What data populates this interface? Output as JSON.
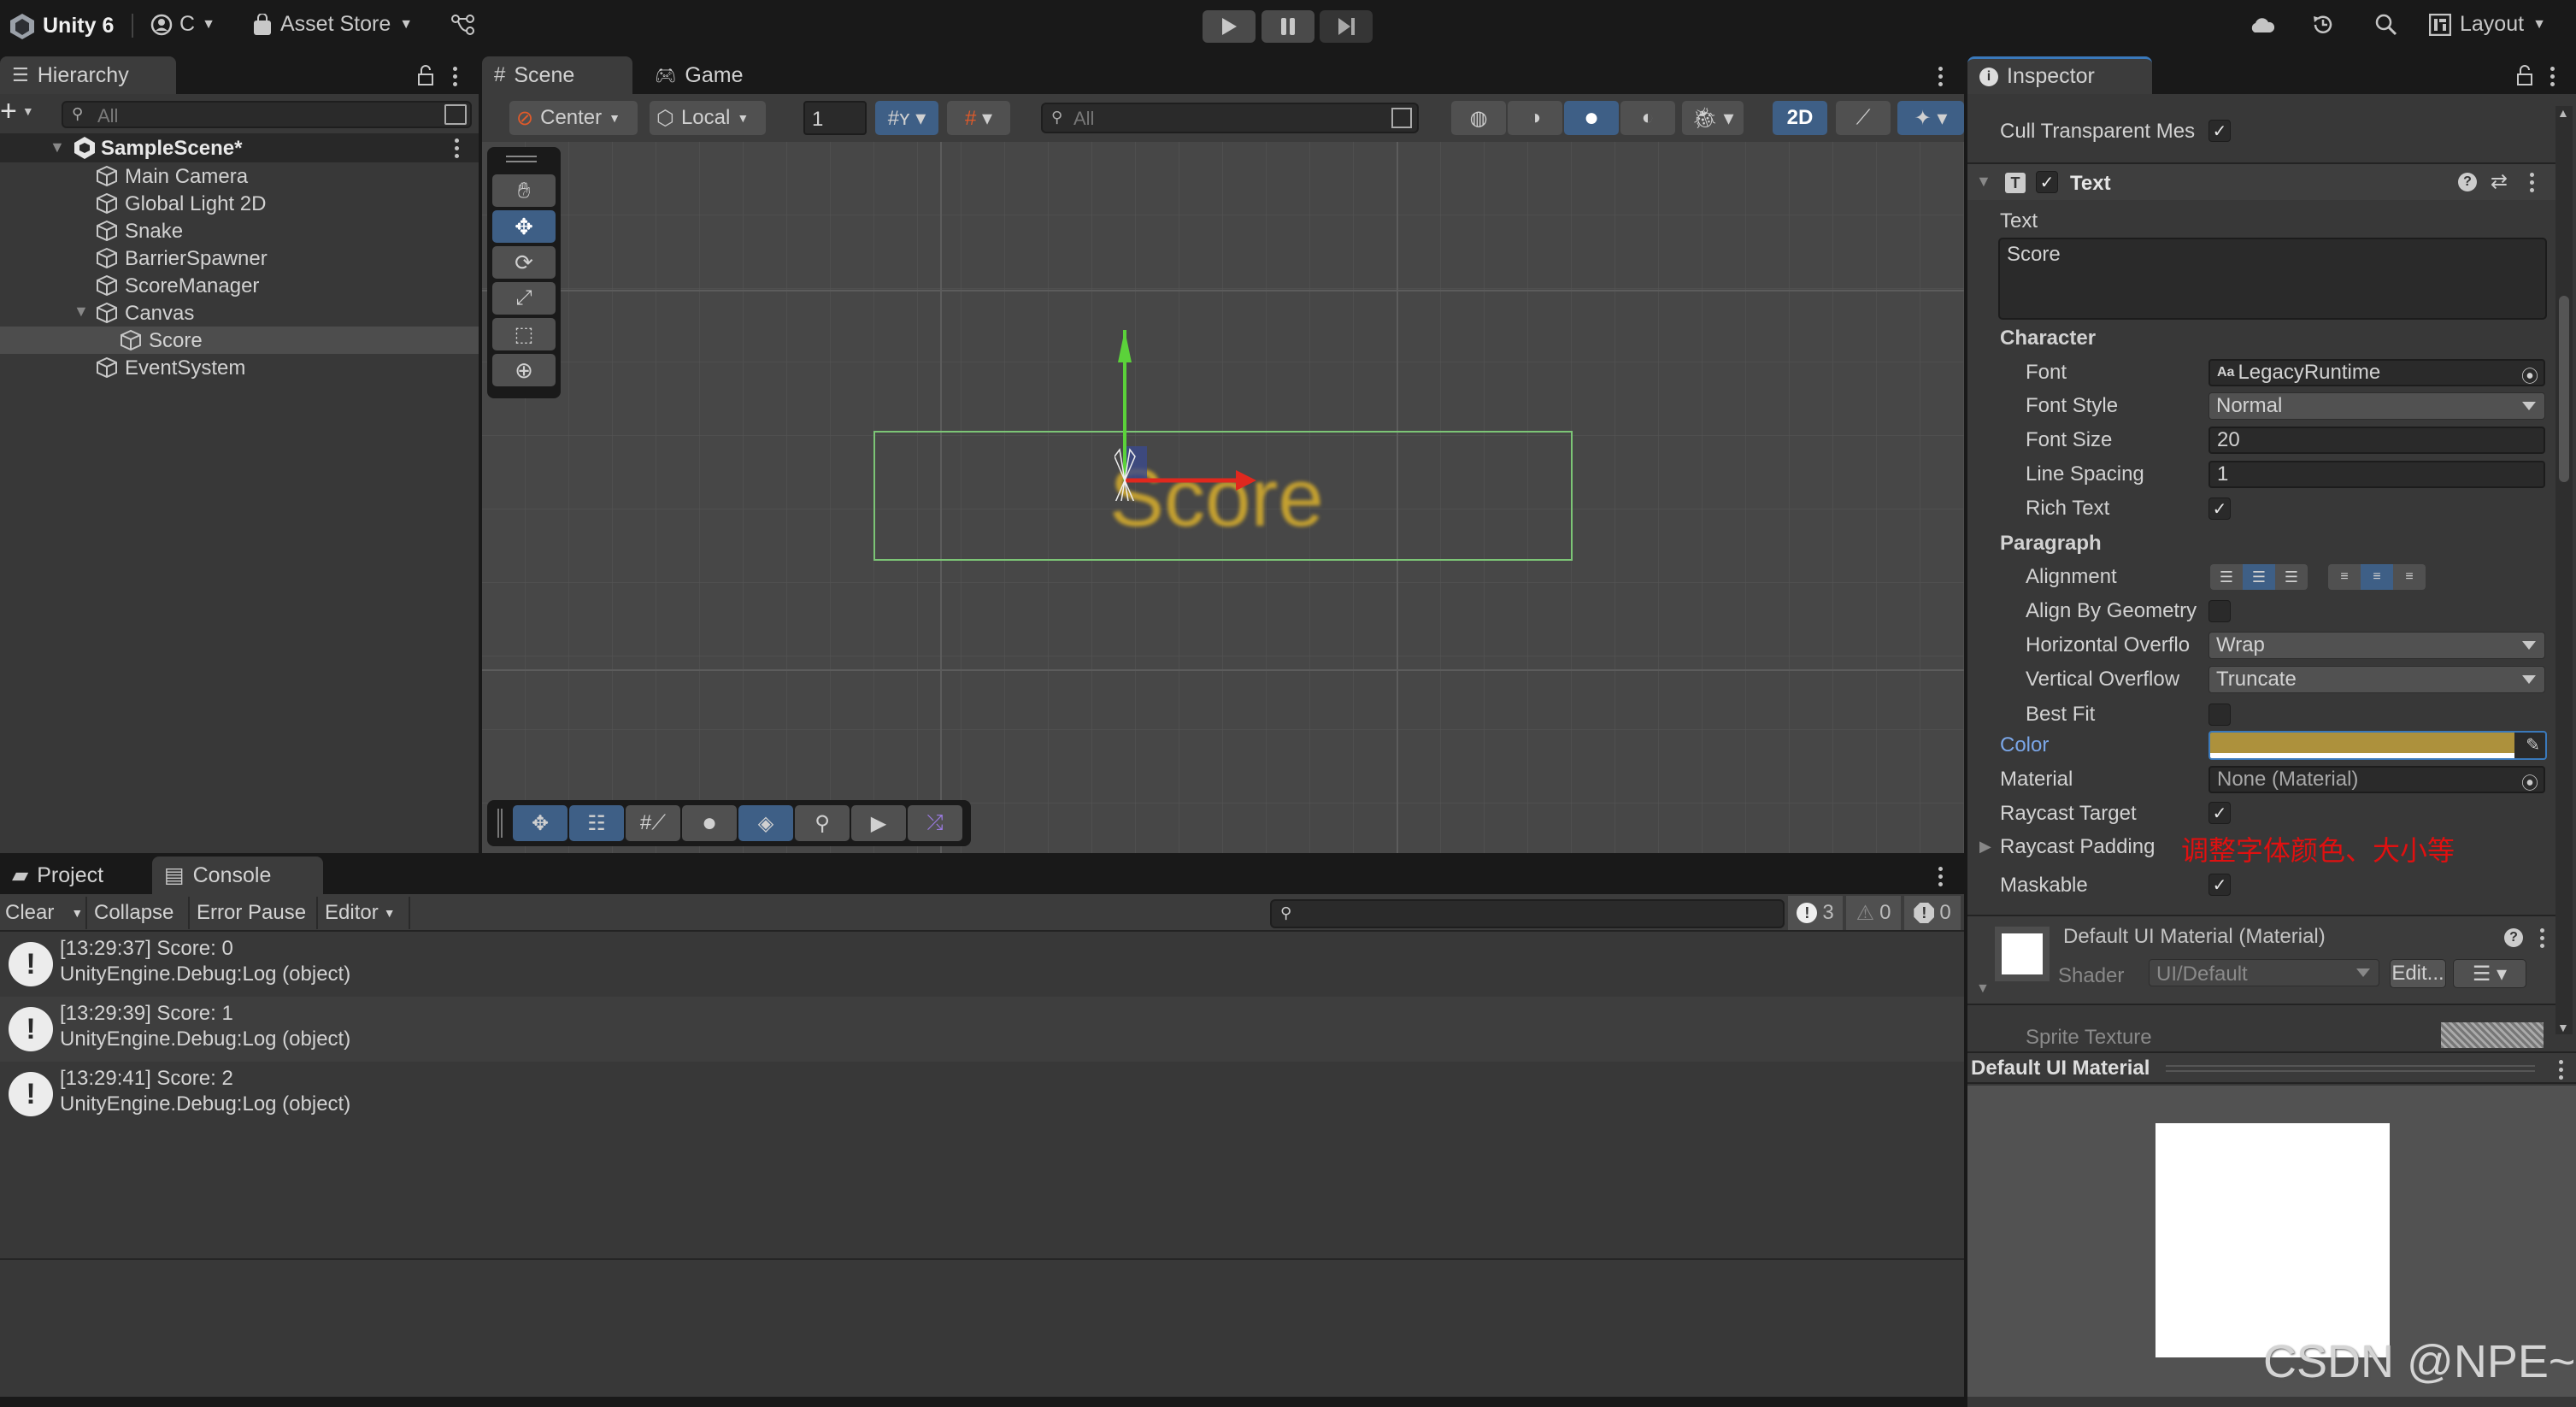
{
  "app": {
    "title": "Unity 6",
    "account": "C",
    "asset_store": "Asset Store",
    "layout": "Layout"
  },
  "hierarchy": {
    "tab": "Hierarchy",
    "search_placeholder": "All",
    "scene": "SampleScene*",
    "items": [
      {
        "label": "Main Camera",
        "depth": 1
      },
      {
        "label": "Global Light 2D",
        "depth": 1
      },
      {
        "label": "Snake",
        "depth": 1
      },
      {
        "label": "BarrierSpawner",
        "depth": 1
      },
      {
        "label": "ScoreManager",
        "depth": 1
      },
      {
        "label": "Canvas",
        "depth": 1,
        "expanded": true
      },
      {
        "label": "Score",
        "depth": 2,
        "selected": true
      },
      {
        "label": "EventSystem",
        "depth": 1
      }
    ]
  },
  "scene": {
    "tabs": [
      "Scene",
      "Game"
    ],
    "pivot": "Center",
    "space": "Local",
    "grid_size": "1",
    "search_placeholder": "All",
    "mode_2d": "2D",
    "object_text": "Score",
    "object_text_color": "#c4a030"
  },
  "inspector": {
    "tab": "Inspector",
    "cull_transparent_label": "Cull Transparent Mes",
    "cull_transparent": true,
    "component": "Text",
    "text_label": "Text",
    "text_value": "Score",
    "character_header": "Character",
    "font_label": "Font",
    "font_value": "LegacyRuntime",
    "font_style_label": "Font Style",
    "font_style_value": "Normal",
    "font_size_label": "Font Size",
    "font_size_value": "20",
    "line_spacing_label": "Line Spacing",
    "line_spacing_value": "1",
    "rich_text_label": "Rich Text",
    "rich_text": true,
    "paragraph_header": "Paragraph",
    "alignment_label": "Alignment",
    "align_geometry_label": "Align By Geometry",
    "h_overflow_label": "Horizontal Overflo",
    "h_overflow_value": "Wrap",
    "v_overflow_label": "Vertical Overflow",
    "v_overflow_value": "Truncate",
    "best_fit_label": "Best Fit",
    "color_label": "Color",
    "color_value": "#ad913c",
    "material_label": "Material",
    "material_value": "None (Material)",
    "raycast_target_label": "Raycast Target",
    "raycast_padding_label": "Raycast Padding",
    "annotation": "调整字体颜色、大小等",
    "maskable_label": "Maskable",
    "material_name": "Default UI Material (Material)",
    "shader_label": "Shader",
    "shader_value": "UI/Default",
    "edit_button": "Edit...",
    "sprite_texture_label": "Sprite Texture",
    "preview_title": "Default UI Material"
  },
  "console": {
    "tabs": [
      "Project",
      "Console"
    ],
    "clear": "Clear",
    "collapse": "Collapse",
    "error_pause": "Error Pause",
    "editor": "Editor",
    "log_count": "3",
    "warn_count": "0",
    "error_count": "0",
    "logs": [
      {
        "line1": "[13:29:37] Score: 0",
        "line2": "UnityEngine.Debug:Log (object)"
      },
      {
        "line1": "[13:29:39] Score: 1",
        "line2": "UnityEngine.Debug:Log (object)"
      },
      {
        "line1": "[13:29:41] Score: 2",
        "line2": "UnityEngine.Debug:Log (object)"
      }
    ]
  },
  "watermark": "CSDN @NPE~"
}
